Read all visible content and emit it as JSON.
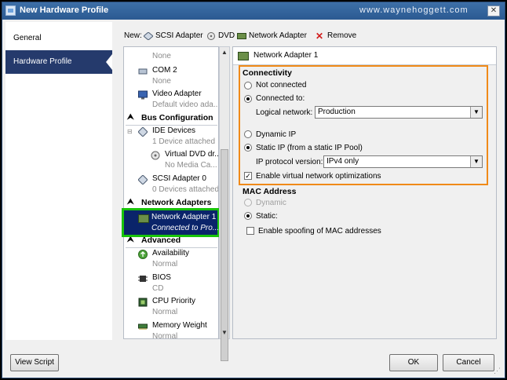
{
  "window": {
    "title": "New Hardware Profile",
    "watermark": "www.waynehoggett.com",
    "close_glyph": "✕"
  },
  "leftnav": {
    "items": [
      {
        "label": "General",
        "selected": false
      },
      {
        "label": "Hardware Profile",
        "selected": true
      }
    ]
  },
  "toolbar": {
    "new_label": "New:",
    "scsi_label": "SCSI Adapter",
    "dvd_label": "DVD",
    "network_label": "Network Adapter",
    "remove_label": "Remove"
  },
  "tree": {
    "com1_value": "None",
    "com2": {
      "label": "COM 2",
      "value": "None"
    },
    "video": {
      "label": "Video Adapter",
      "value": "Default video ada..."
    },
    "bus_header": "Bus Configuration",
    "ide": {
      "label": "IDE Devices",
      "value": "1 Device attached"
    },
    "dvd": {
      "label": "Virtual DVD dr...",
      "value": "No Media Ca..."
    },
    "scsi": {
      "label": "SCSI Adapter 0",
      "value": "0 Devices attached"
    },
    "net_header": "Network Adapters",
    "net_adapter": {
      "label": "Network Adapter 1",
      "value": "Connected to Pro..."
    },
    "adv_header": "Advanced",
    "availability": {
      "label": "Availability",
      "value": "Normal"
    },
    "bios": {
      "label": "BIOS",
      "value": "CD"
    },
    "cpu": {
      "label": "CPU Priority",
      "value": "Normal"
    },
    "memory": {
      "label": "Memory Weight",
      "value": "Normal"
    }
  },
  "panel": {
    "header": "Network Adapter 1",
    "connectivity": {
      "title": "Connectivity",
      "not_connected": "Not connected",
      "connected_to": "Connected to:",
      "logical_network_label": "Logical network:",
      "logical_network_value": "Production",
      "dynamic_ip": "Dynamic IP",
      "static_ip": "Static IP (from a static IP Pool)",
      "ip_protocol_label": "IP protocol version:",
      "ip_protocol_value": "IPv4 only",
      "enable_optimizations": "Enable virtual network optimizations"
    },
    "mac": {
      "title": "MAC Address",
      "dynamic": "Dynamic",
      "static": "Static:",
      "spoofing": "Enable spoofing of MAC addresses"
    }
  },
  "footer": {
    "view_script": "View Script",
    "ok": "OK",
    "cancel": "Cancel"
  }
}
